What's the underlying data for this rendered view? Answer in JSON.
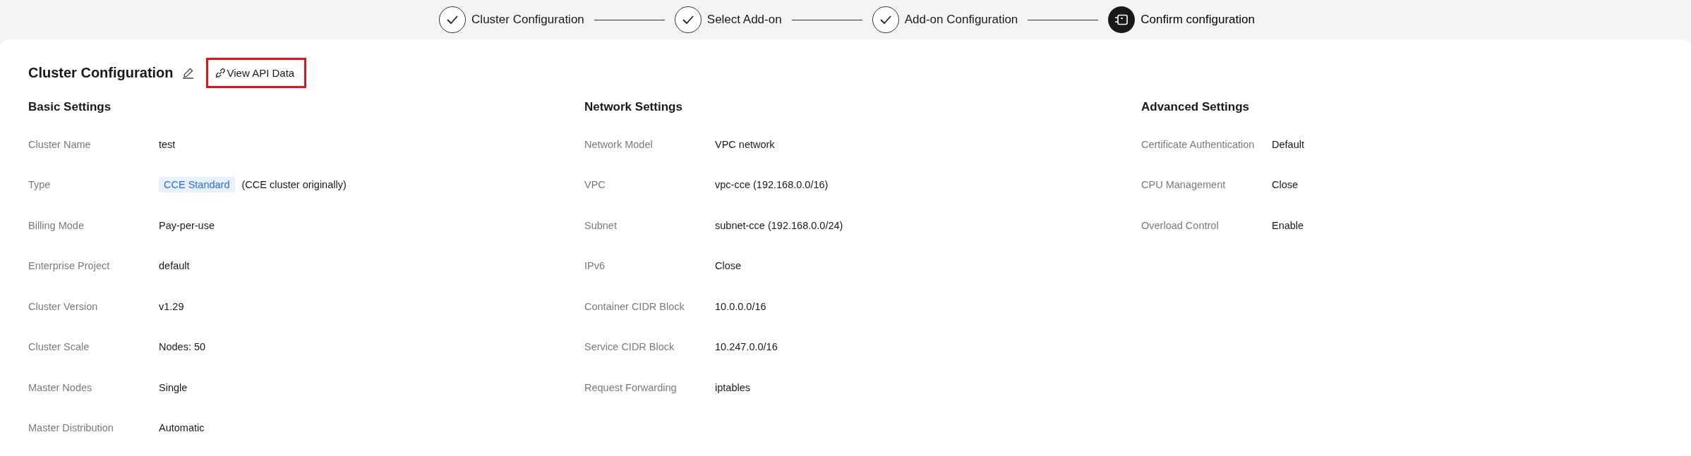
{
  "steps": [
    {
      "label": "Cluster Configuration",
      "kind": "done"
    },
    {
      "label": "Select Add-on",
      "kind": "done"
    },
    {
      "label": "Add-on Configuration",
      "kind": "done"
    },
    {
      "label": "Confirm configuration",
      "kind": "current"
    }
  ],
  "panel": {
    "title": "Cluster Configuration",
    "link": {
      "label": "View API Data",
      "highlighted": true
    },
    "sections": [
      {
        "title": "Basic Settings",
        "rows": [
          {
            "label": "Cluster Name",
            "value": "test"
          },
          {
            "label": "Type",
            "kind": "tag",
            "tag": "CCE Standard",
            "value": "(CCE cluster originally)"
          },
          {
            "label": "Billing Mode",
            "value": "Pay-per-use"
          },
          {
            "label": "Enterprise Project",
            "value": "default"
          },
          {
            "label": "Cluster Version",
            "value": "v1.29"
          },
          {
            "label": "Cluster Scale",
            "value": "Nodes: 50"
          },
          {
            "label": "Master Nodes",
            "value": "Single"
          },
          {
            "label": "Master Distribution",
            "value": "Automatic"
          }
        ]
      },
      {
        "title": "Network Settings",
        "rows": [
          {
            "label": "Network Model",
            "value": "VPC network"
          },
          {
            "label": "VPC",
            "value": "vpc-cce (192.168.0.0/16)"
          },
          {
            "label": "Subnet",
            "value": "subnet-cce (192.168.0.0/24)"
          },
          {
            "label": "IPv6",
            "value": "Close"
          },
          {
            "label": "Container CIDR Block",
            "value": "10.0.0.0/16"
          },
          {
            "label": "Service CIDR Block",
            "value": "10.247.0.0/16"
          },
          {
            "label": "Request Forwarding",
            "value": "iptables"
          }
        ]
      },
      {
        "title": "Advanced Settings",
        "rows": [
          {
            "label": "Certificate Authentication",
            "value": "Default"
          },
          {
            "label": "CPU Management",
            "value": "Close"
          },
          {
            "label": "Overload Control",
            "value": "Enable"
          }
        ]
      }
    ]
  }
}
